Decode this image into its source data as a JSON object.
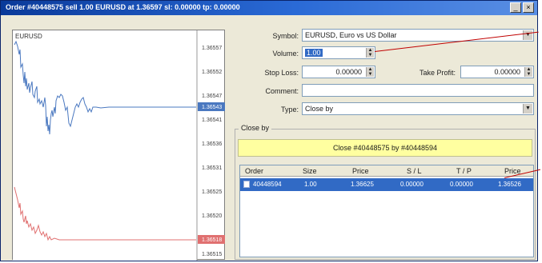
{
  "window": {
    "title": "Order #40448575 sell 1.00 EURUSD at 1.36597 sl: 0.00000 tp: 0.00000",
    "minimize_glyph": "_",
    "close_glyph": "×"
  },
  "chart": {
    "symbol_label": "EURUSD",
    "price_ticks": [
      "1.36557",
      "1.36552",
      "1.36547",
      "1.36541",
      "1.36536",
      "1.36531",
      "1.36525",
      "1.36520",
      "1.36515"
    ],
    "bid_marker": "1.36543",
    "ask_marker": "1.36518",
    "bid_color": "#4a78c0",
    "ask_color": "#e07070"
  },
  "form": {
    "symbol_label": "Symbol:",
    "symbol_value": "EURUSD, Euro vs US Dollar",
    "volume_label": "Volume:",
    "volume_value": "1.00",
    "stop_loss_label": "Stop Loss:",
    "stop_loss_value": "0.00000",
    "take_profit_label": "Take Profit:",
    "take_profit_value": "0.00000",
    "comment_label": "Comment:",
    "comment_value": "",
    "type_label": "Type:",
    "type_value": "Close by"
  },
  "close_by": {
    "group_label": "Close by",
    "button_label": "Close #40448575 by #40448594",
    "button_color": "#ffffa0",
    "columns": [
      "Order",
      "Size",
      "Price",
      "S / L",
      "T / P",
      "Price"
    ],
    "rows": [
      {
        "order": "40448594",
        "size": "1.00",
        "price": "1.36625",
        "sl": "0.00000",
        "tp": "0.00000",
        "current_price": "1.36526"
      }
    ]
  }
}
